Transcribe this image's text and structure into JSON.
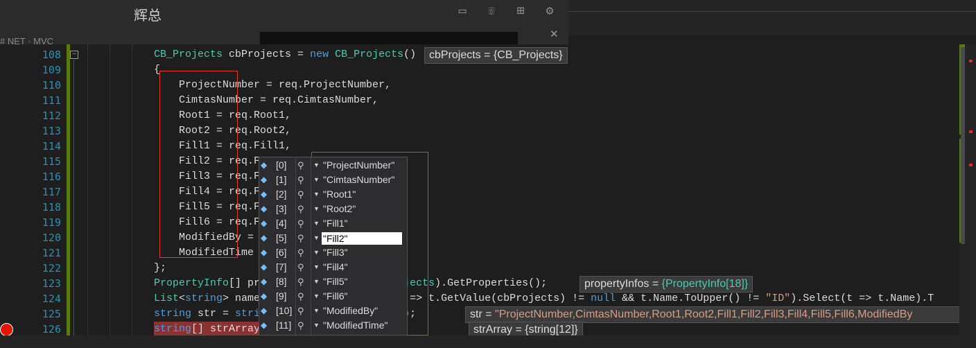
{
  "window": {
    "title": "辉总",
    "left_label": "# NET · MVC"
  },
  "gutter": {
    "line_numbers": [
      "108",
      "109",
      "110",
      "111",
      "112",
      "113",
      "114",
      "115",
      "116",
      "117",
      "118",
      "119",
      "120",
      "121",
      "122",
      "123",
      "124",
      "125",
      "126"
    ]
  },
  "code": {
    "lines": [
      [
        {
          "t": "CB_Projects",
          "c": "ty"
        },
        {
          "t": " cbProjects = ",
          "c": ""
        },
        {
          "t": "new",
          "c": "kw"
        },
        {
          "t": " ",
          "c": ""
        },
        {
          "t": "CB_Projects",
          "c": "ty"
        },
        {
          "t": "()",
          "c": ""
        }
      ],
      [
        {
          "t": "{",
          "c": ""
        }
      ],
      [
        {
          "t": "    ProjectNumber = req.ProjectNumber,",
          "c": ""
        }
      ],
      [
        {
          "t": "    CimtasNumber = req.CimtasNumber,",
          "c": ""
        }
      ],
      [
        {
          "t": "    Root1 = req.Root1,",
          "c": ""
        }
      ],
      [
        {
          "t": "    Root2 = req.Root2,",
          "c": ""
        }
      ],
      [
        {
          "t": "    Fill1 = req.Fill1,",
          "c": ""
        }
      ],
      [
        {
          "t": "    Fill2 = req.F",
          "c": ""
        }
      ],
      [
        {
          "t": "    Fill3 = req.F",
          "c": ""
        }
      ],
      [
        {
          "t": "    Fill4 = req.F",
          "c": ""
        }
      ],
      [
        {
          "t": "    Fill5 = req.F",
          "c": ""
        }
      ],
      [
        {
          "t": "    Fill6 = req.F",
          "c": ""
        }
      ],
      [
        {
          "t": "    ModifiedBy = ",
          "c": ""
        }
      ],
      [
        {
          "t": "    ModifiedTime",
          "c": ""
        }
      ],
      [
        {
          "t": "};",
          "c": ""
        }
      ],
      [
        {
          "t": "PropertyInfo",
          "c": "ty"
        },
        {
          "t": "[] pr",
          "c": ""
        },
        {
          "t": "                   ",
          "c": ""
        },
        {
          "t": "_Projects",
          "c": "ty"
        },
        {
          "t": ").GetProperties();",
          "c": ""
        }
      ],
      [
        {
          "t": "List",
          "c": "ty"
        },
        {
          "t": "<",
          "c": ""
        },
        {
          "t": "string",
          "c": "kw"
        },
        {
          "t": "> name",
          "c": ""
        },
        {
          "t": "                  ",
          "c": ""
        },
        {
          "t": "ere(t => t.GetValue(cbProjects) != ",
          "c": ""
        },
        {
          "t": "null",
          "c": "kw"
        },
        {
          "t": " && t.Name.ToUpper() != ",
          "c": ""
        },
        {
          "t": "\"ID\"",
          "c": "str"
        },
        {
          "t": ").Select(t => t.Name).T",
          "c": ""
        }
      ],
      [
        {
          "t": "string",
          "c": "kw"
        },
        {
          "t": " str = ",
          "c": ""
        },
        {
          "t": "stri",
          "c": "kw"
        },
        {
          "t": "                 ",
          "c": ""
        },
        {
          "t": "meList);",
          "c": ""
        }
      ],
      [
        {
          "t": "string",
          "c": "kw"
        },
        {
          "t": "[] strArray",
          "c": ""
        },
        {
          "t": "                 ",
          "c": ""
        },
        {
          "t": "','",
          "c": "str"
        },
        {
          "t": ");",
          "c": ""
        }
      ]
    ]
  },
  "datatips": {
    "cbProjects": {
      "name": "cbProjects = ",
      "value": "{CB_Projects}"
    },
    "propertyInfos": {
      "name": "propertyInfos = ",
      "value": "{PropertyInfo[18]}"
    },
    "str": {
      "name": "str = ",
      "value": "\"ProjectNumber,CimtasNumber,Root1,Root2,Fill1,Fill2,Fill3,Fill4,Fill5,Fill6,ModifiedBy"
    },
    "strArray": {
      "name": "strArray = ",
      "value": "{string[12]}"
    }
  },
  "array_tip": {
    "items": [
      {
        "index": "[0]",
        "value": "\"ProjectNumber\""
      },
      {
        "index": "[1]",
        "value": "\"CimtasNumber\""
      },
      {
        "index": "[2]",
        "value": "\"Root1\""
      },
      {
        "index": "[3]",
        "value": "\"Root2\""
      },
      {
        "index": "[4]",
        "value": "\"Fill1\""
      },
      {
        "index": "[5]",
        "value": "\"Fill2\""
      },
      {
        "index": "[6]",
        "value": "\"Fill3\""
      },
      {
        "index": "[7]",
        "value": "\"Fill4\""
      },
      {
        "index": "[8]",
        "value": "\"Fill5\""
      },
      {
        "index": "[9]",
        "value": "\"Fill6\""
      },
      {
        "index": "[10]",
        "value": "\"ModifiedBy\""
      },
      {
        "index": "[11]",
        "value": "\"ModifiedTime\""
      }
    ],
    "editing_index": 5
  },
  "colors": {
    "breakpoint": "#e51400",
    "highlight_box": "#e53935",
    "change_bar": "#587c0c"
  }
}
